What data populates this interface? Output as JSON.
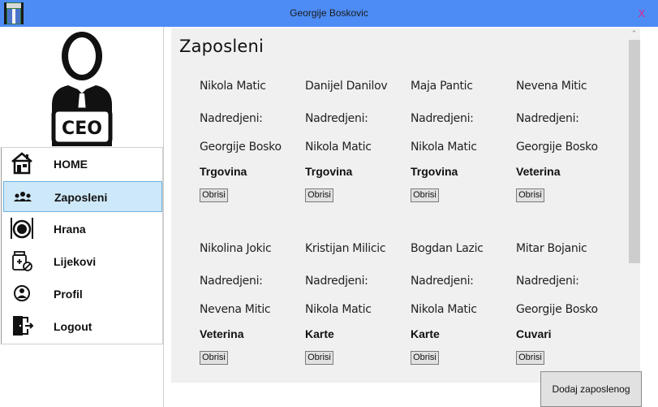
{
  "window": {
    "title": "Georgije Boskovic",
    "close_label": "X"
  },
  "sidebar": {
    "logo_text": "CEO",
    "items": [
      {
        "label": "HOME",
        "icon": "home-icon"
      },
      {
        "label": "Zaposleni",
        "icon": "people-icon",
        "active": true
      },
      {
        "label": "Hrana",
        "icon": "food-icon"
      },
      {
        "label": "Lijekovi",
        "icon": "medicine-icon"
      },
      {
        "label": "Profil",
        "icon": "profile-icon"
      },
      {
        "label": "Logout",
        "icon": "logout-icon"
      }
    ]
  },
  "main": {
    "title": "Zaposleni",
    "supervisor_label": "Nadredjeni:",
    "delete_label": "Obrisi",
    "add_button_label": "Dodaj zaposlenog",
    "employees": [
      {
        "name": "Nikola Matic",
        "supervisor": "Georgije Bosko",
        "department": "Trgovina"
      },
      {
        "name": "Danijel Danilov",
        "supervisor": "Nikola Matic",
        "department": "Trgovina"
      },
      {
        "name": "Maja Pantic",
        "supervisor": "Nikola Matic",
        "department": "Trgovina"
      },
      {
        "name": "Nevena Mitic",
        "supervisor": "Georgije Bosko",
        "department": "Veterina"
      },
      {
        "name": "Nikolina Jokic",
        "supervisor": "Nevena Mitic",
        "department": "Veterina"
      },
      {
        "name": "Kristijan Milicic",
        "supervisor": "Nikola Matic",
        "department": "Karte"
      },
      {
        "name": "Bogdan Lazic",
        "supervisor": "Nikola Matic",
        "department": "Karte"
      },
      {
        "name": "Mitar Bojanic",
        "supervisor": "Georgije Bosko",
        "department": "Cuvari"
      }
    ]
  },
  "colors": {
    "titlebar": "#4d8cf5",
    "active_nav": "#cde8f8",
    "panel": "#f0f0f0",
    "close": "#e0208a"
  }
}
